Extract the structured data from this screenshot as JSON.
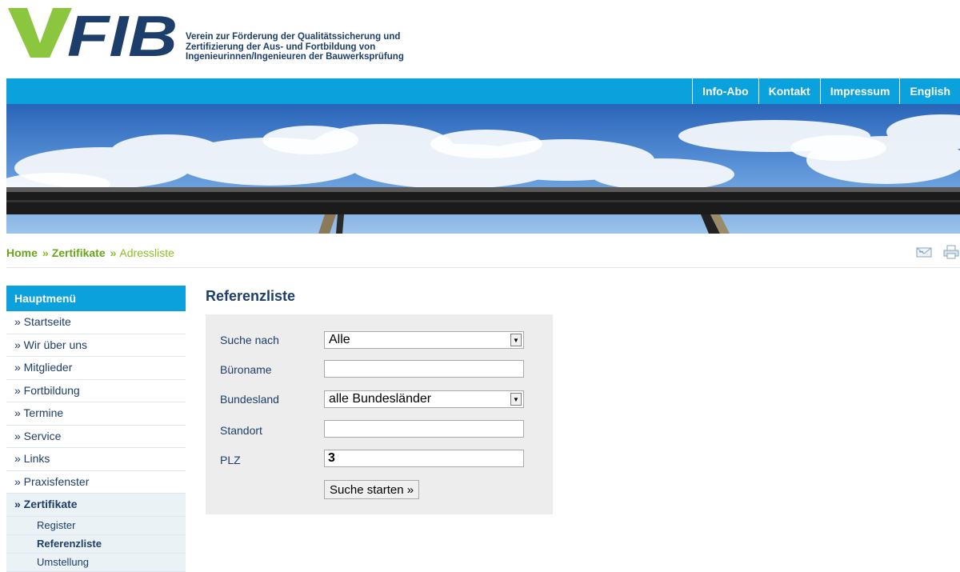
{
  "header": {
    "logo_text": "VFIB",
    "tagline": [
      "Verein zur Förderung der Qualitätssicherung und",
      "Zertifizierung der Aus- und Fortbildung von",
      "Ingenieurinnen/Ingenieuren der Bauwerksprüfung"
    ],
    "brand_colors": {
      "green": "#8cc63f",
      "navy": "#1d3d6b",
      "blue": "#0aa1dc"
    }
  },
  "top_nav": [
    {
      "label": "Info-Abo"
    },
    {
      "label": "Kontakt"
    },
    {
      "label": "Impressum"
    },
    {
      "label": "English"
    }
  ],
  "breadcrumb": {
    "items": [
      "Home",
      "Zertifikate",
      "Adressliste"
    ],
    "separator": "»"
  },
  "tools": {
    "email_icon": "email-icon",
    "print_icon": "print-icon"
  },
  "sidebar": {
    "title": "Hauptmenü",
    "items": [
      "» Startseite",
      "» Wir über uns",
      "» Mitglieder",
      "» Fortbildung",
      "» Termine",
      "» Service",
      "» Links",
      "» Praxisfenster",
      "» Zertifikate"
    ],
    "active_index": 8,
    "subitems": [
      "Register",
      "Referenzliste",
      "Umstellung"
    ],
    "current_subitem": "Referenzliste"
  },
  "main": {
    "title": "Referenzliste",
    "form": {
      "search_by_label": "Suche nach",
      "search_by_value": "Alle",
      "office_name_label": "Büroname",
      "office_name_value": "",
      "state_label": "Bundesland",
      "state_value": "alle Bundesländer",
      "location_label": "Standort",
      "location_value": "",
      "plz_label": "PLZ",
      "plz_value": "3",
      "submit_label": "Suche starten »"
    }
  }
}
